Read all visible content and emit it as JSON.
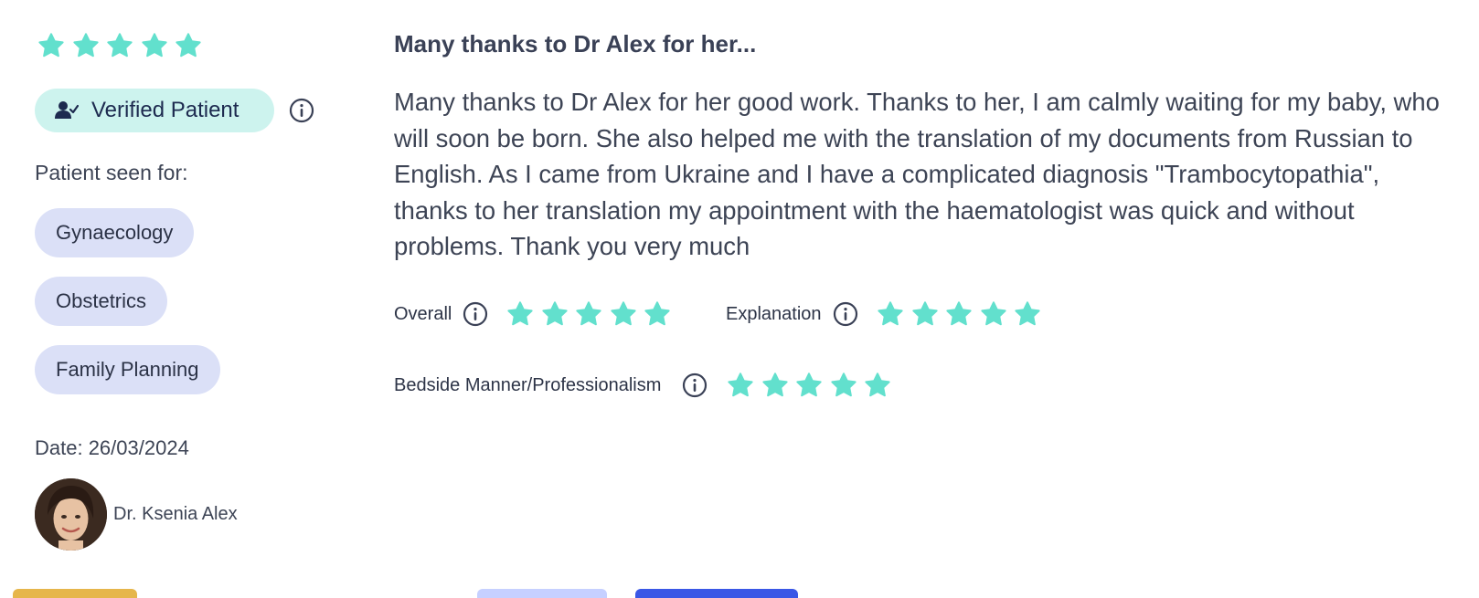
{
  "review": {
    "overall_stars": 5,
    "verified_badge": {
      "label": "Verified Patient",
      "icon": "user-check-icon"
    },
    "seen_for_label": "Patient seen for:",
    "specialties": [
      "Gynaecology",
      "Obstetrics",
      "Family Planning"
    ],
    "date": "Date: 26/03/2024",
    "doctor": {
      "name": "Dr. Ksenia Alex"
    },
    "title": "Many thanks to Dr Alex for her...",
    "body": "Many thanks to Dr Alex for her good work. Thanks to her, I am calmly waiting for my baby, who will soon be born. She also helped me with the translation of my documents from Russian to English. As I came from Ukraine and I have a complicated diagnosis \"Trambocytopathia\", thanks to her translation my appointment with the haematologist was quick and without problems. Thank you very much",
    "ratings": [
      {
        "label": "Overall",
        "stars": 5
      },
      {
        "label": "Explanation",
        "stars": 5
      },
      {
        "label": "Bedside Manner/Professionalism",
        "stars": 5
      }
    ]
  },
  "colors": {
    "star": "#62e0cd",
    "badge_bg": "#cdf3ee",
    "pill_bg": "#dbe0f7",
    "text": "#3d4455"
  }
}
